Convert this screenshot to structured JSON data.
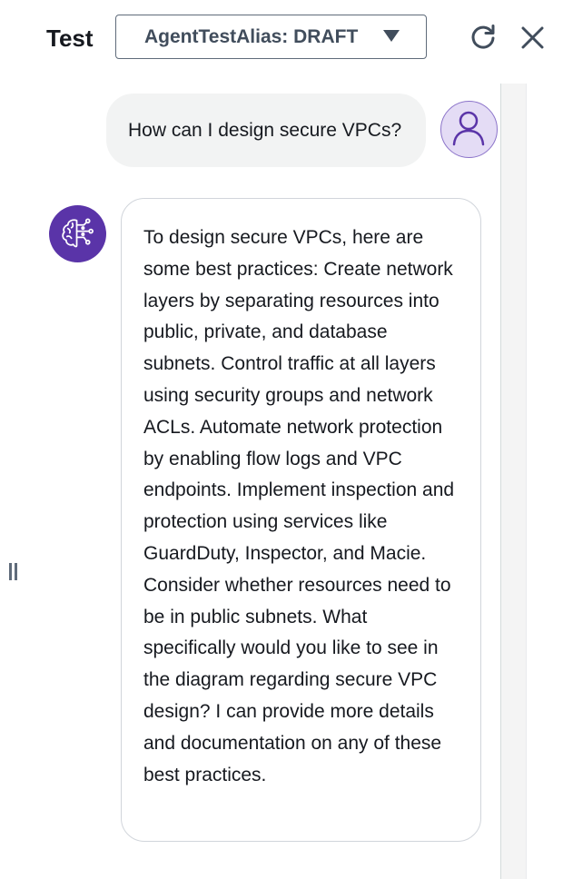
{
  "header": {
    "title": "Test",
    "alias_select": {
      "value": "AgentTestAlias: DRAFT",
      "icon": "caret-down-icon"
    },
    "refresh_icon": "refresh-icon",
    "close_icon": "close-icon"
  },
  "conversation": {
    "messages": [
      {
        "role": "user",
        "text": "How can I design secure VPCs?",
        "avatar_icon": "user-avatar-icon"
      },
      {
        "role": "agent",
        "avatar_icon": "agent-brain-icon",
        "text": "To design secure VPCs, here are some best practices: Create network layers by separating resources into public, private, and database subnets. Control traffic at all layers using security groups and network ACLs. Automate network protection by enabling flow logs and VPC endpoints. Implement inspection and protection using services like GuardDuty, Inspector, and Macie. Consider whether resources need to be in public subnets. What specifically would you like to see in the diagram regarding secure VPC design? I can provide more details and documentation on any of these best practices."
      }
    ]
  },
  "colors": {
    "agent_avatar": "#5a34a8",
    "user_avatar_bg": "#e4dcf5",
    "user_bubble": "#f2f3f3",
    "text": "#16191f"
  }
}
